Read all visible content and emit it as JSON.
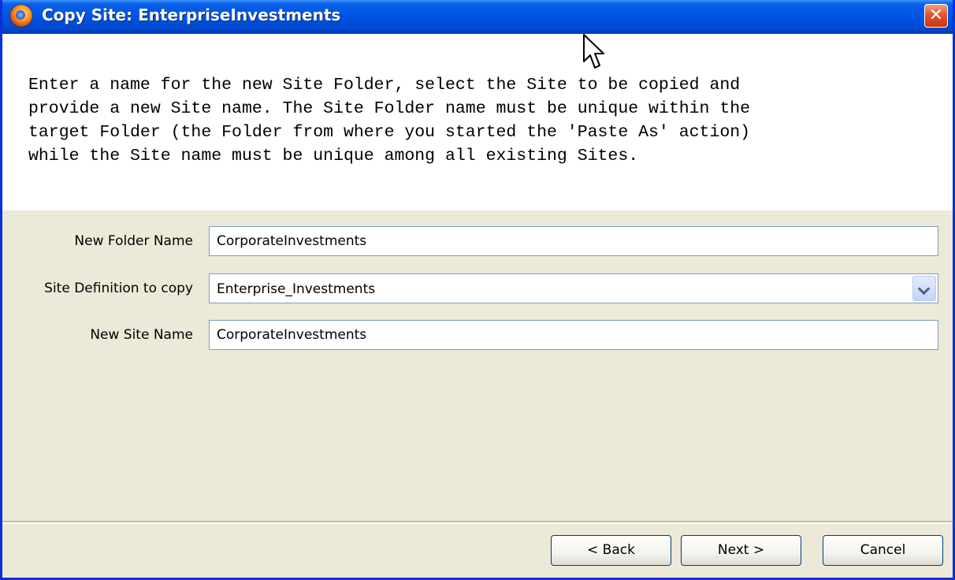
{
  "window": {
    "title": "Copy Site: EnterpriseInvestments",
    "close_label": "✕"
  },
  "instructions": {
    "text": "Enter a name for the new Site Folder, select the Site to be copied and\nprovide a new Site name. The Site Folder name must be unique within the\ntarget Folder (the Folder from where you started the 'Paste As' action)\nwhile the Site name must be unique among all existing Sites."
  },
  "form": {
    "new_folder_name": {
      "label": "New Folder Name",
      "value": "CorporateInvestments"
    },
    "site_definition": {
      "label": "Site Definition to copy",
      "value": "Enterprise_Investments"
    },
    "new_site_name": {
      "label": "New Site Name",
      "value": "CorporateInvestments"
    }
  },
  "buttons": {
    "back": "< Back",
    "next": "Next >",
    "cancel": "Cancel"
  },
  "colors": {
    "titlebar": "#0054e3",
    "dialog_background": "#ece9d8",
    "close_button": "#e1552f",
    "field_border": "#7f9db9"
  },
  "icons": {
    "app": "firefox-icon",
    "close": "close-icon",
    "dropdown": "chevron-down-icon",
    "pointer": "mouse-pointer-icon"
  }
}
